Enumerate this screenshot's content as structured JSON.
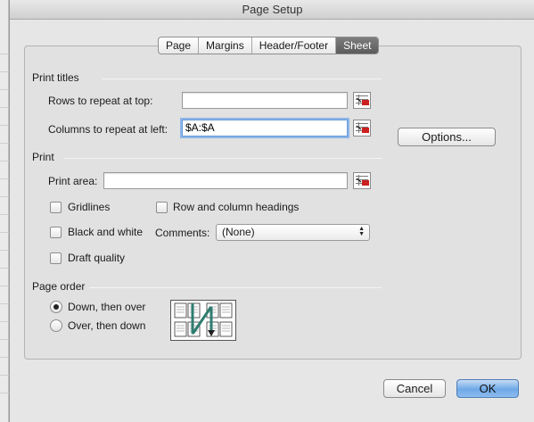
{
  "window": {
    "title": "Page Setup"
  },
  "tabs": [
    {
      "label": "Page",
      "active": false
    },
    {
      "label": "Margins",
      "active": false
    },
    {
      "label": "Header/Footer",
      "active": false
    },
    {
      "label": "Sheet",
      "active": true
    }
  ],
  "print_titles": {
    "heading": "Print titles",
    "rows_label": "Rows to repeat at top:",
    "rows_value": "",
    "cols_label": "Columns to repeat at left:",
    "cols_value": "$A:$A"
  },
  "options_button": "Options...",
  "print": {
    "heading": "Print",
    "area_label": "Print area:",
    "area_value": "",
    "gridlines": {
      "label": "Gridlines",
      "checked": false
    },
    "black_white": {
      "label": "Black and white",
      "checked": false
    },
    "draft": {
      "label": "Draft quality",
      "checked": false
    },
    "row_col_headings": {
      "label": "Row and column headings",
      "checked": false
    },
    "comments_label": "Comments:",
    "comments_value": "(None)"
  },
  "page_order": {
    "heading": "Page order",
    "down_then_over": {
      "label": "Down, then over",
      "selected": true
    },
    "over_then_down": {
      "label": "Over, then down",
      "selected": false
    }
  },
  "buttons": {
    "cancel": "Cancel",
    "ok": "OK"
  },
  "colors": {
    "accent": "#6ea8e8",
    "focus": "#8cb6ea",
    "picker_red": "#cc1f1f"
  }
}
